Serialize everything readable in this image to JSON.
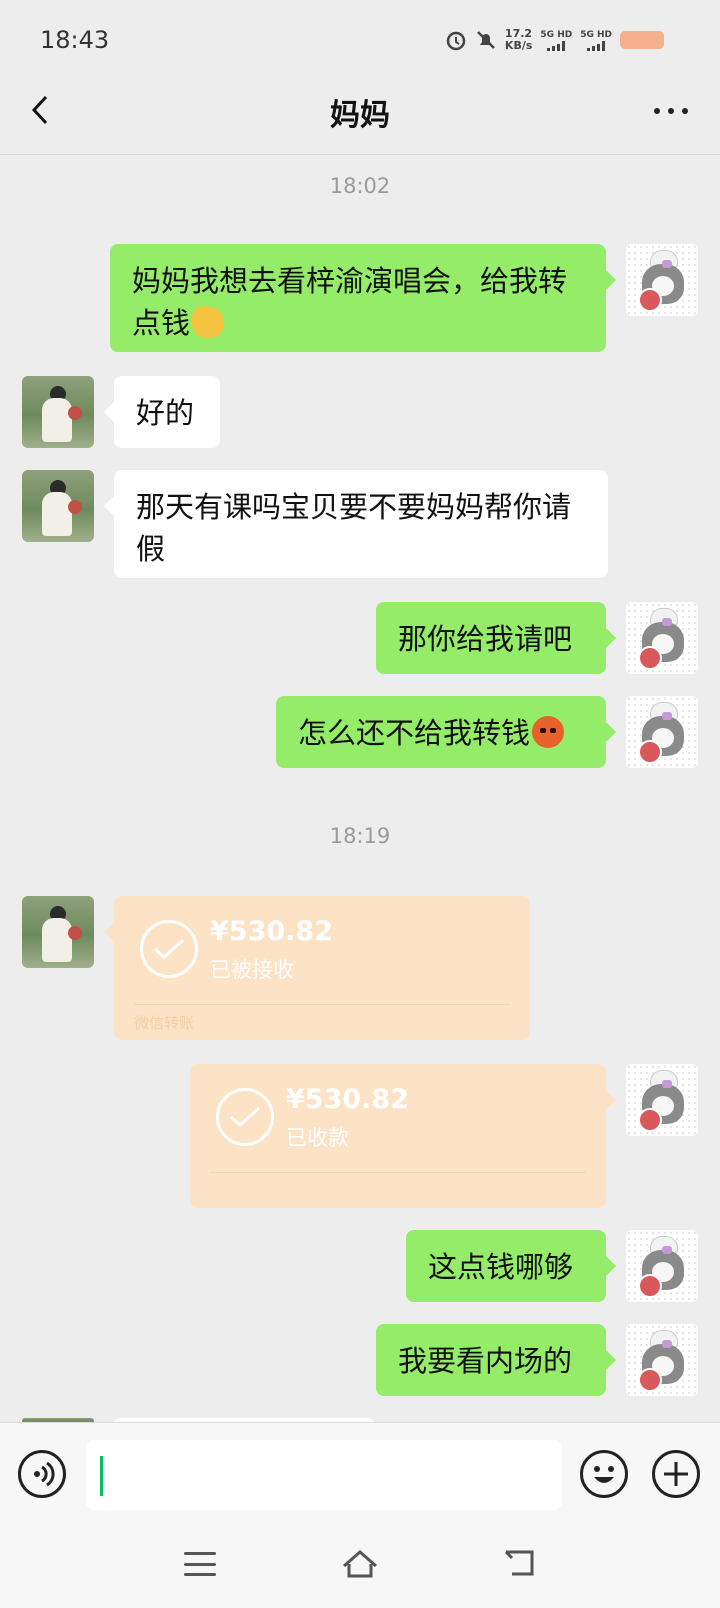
{
  "status_bar": {
    "time": "18:43",
    "net_speed_value": "17.2",
    "net_speed_unit": "KB/s",
    "sim1": "5G HD",
    "sim2": "5G HD",
    "icons": [
      "alarm-icon",
      "mute-icon",
      "signal-icon",
      "battery-icon"
    ]
  },
  "header": {
    "title": "妈妈",
    "back_icon": "chevron-left-icon",
    "more_icon": "more-dots-icon"
  },
  "messages": [
    {
      "type": "timestamp",
      "text": "18:02"
    },
    {
      "type": "text",
      "from": "me",
      "text": "妈妈我想去看梓渝演唱会，给我转点钱",
      "emoji": "pray-hands-emoji"
    },
    {
      "type": "text",
      "from": "mom",
      "text": "好的"
    },
    {
      "type": "text",
      "from": "mom",
      "text": "那天有课吗宝贝要不要妈妈帮你请假"
    },
    {
      "type": "text",
      "from": "me",
      "text": "那你给我请吧"
    },
    {
      "type": "text",
      "from": "me",
      "text": "怎么还不给我转钱",
      "emoji": "angry-face-emoji"
    },
    {
      "type": "timestamp",
      "text": "18:19"
    },
    {
      "type": "transfer",
      "from": "mom",
      "amount": "¥530.82",
      "status": "已被接收",
      "footer": "微信转账"
    },
    {
      "type": "transfer",
      "from": "me",
      "amount": "¥530.82",
      "status": "已收款",
      "footer": ""
    },
    {
      "type": "text",
      "from": "me",
      "text": "这点钱哪够"
    },
    {
      "type": "text",
      "from": "me",
      "text": "我要看内场的"
    }
  ],
  "input_bar": {
    "value": "",
    "voice_icon": "voice-icon",
    "emoji_icon": "smile-icon",
    "plus_icon": "plus-icon"
  },
  "nav_bar": {
    "icons": [
      "menu-icon",
      "home-icon",
      "back-icon"
    ]
  },
  "colors": {
    "background": "#ededed",
    "outgoing_bubble": "#95ec69",
    "incoming_bubble": "#ffffff",
    "transfer_card": "#fde3c5",
    "battery": "#f4b08c",
    "caret": "#07c160"
  }
}
